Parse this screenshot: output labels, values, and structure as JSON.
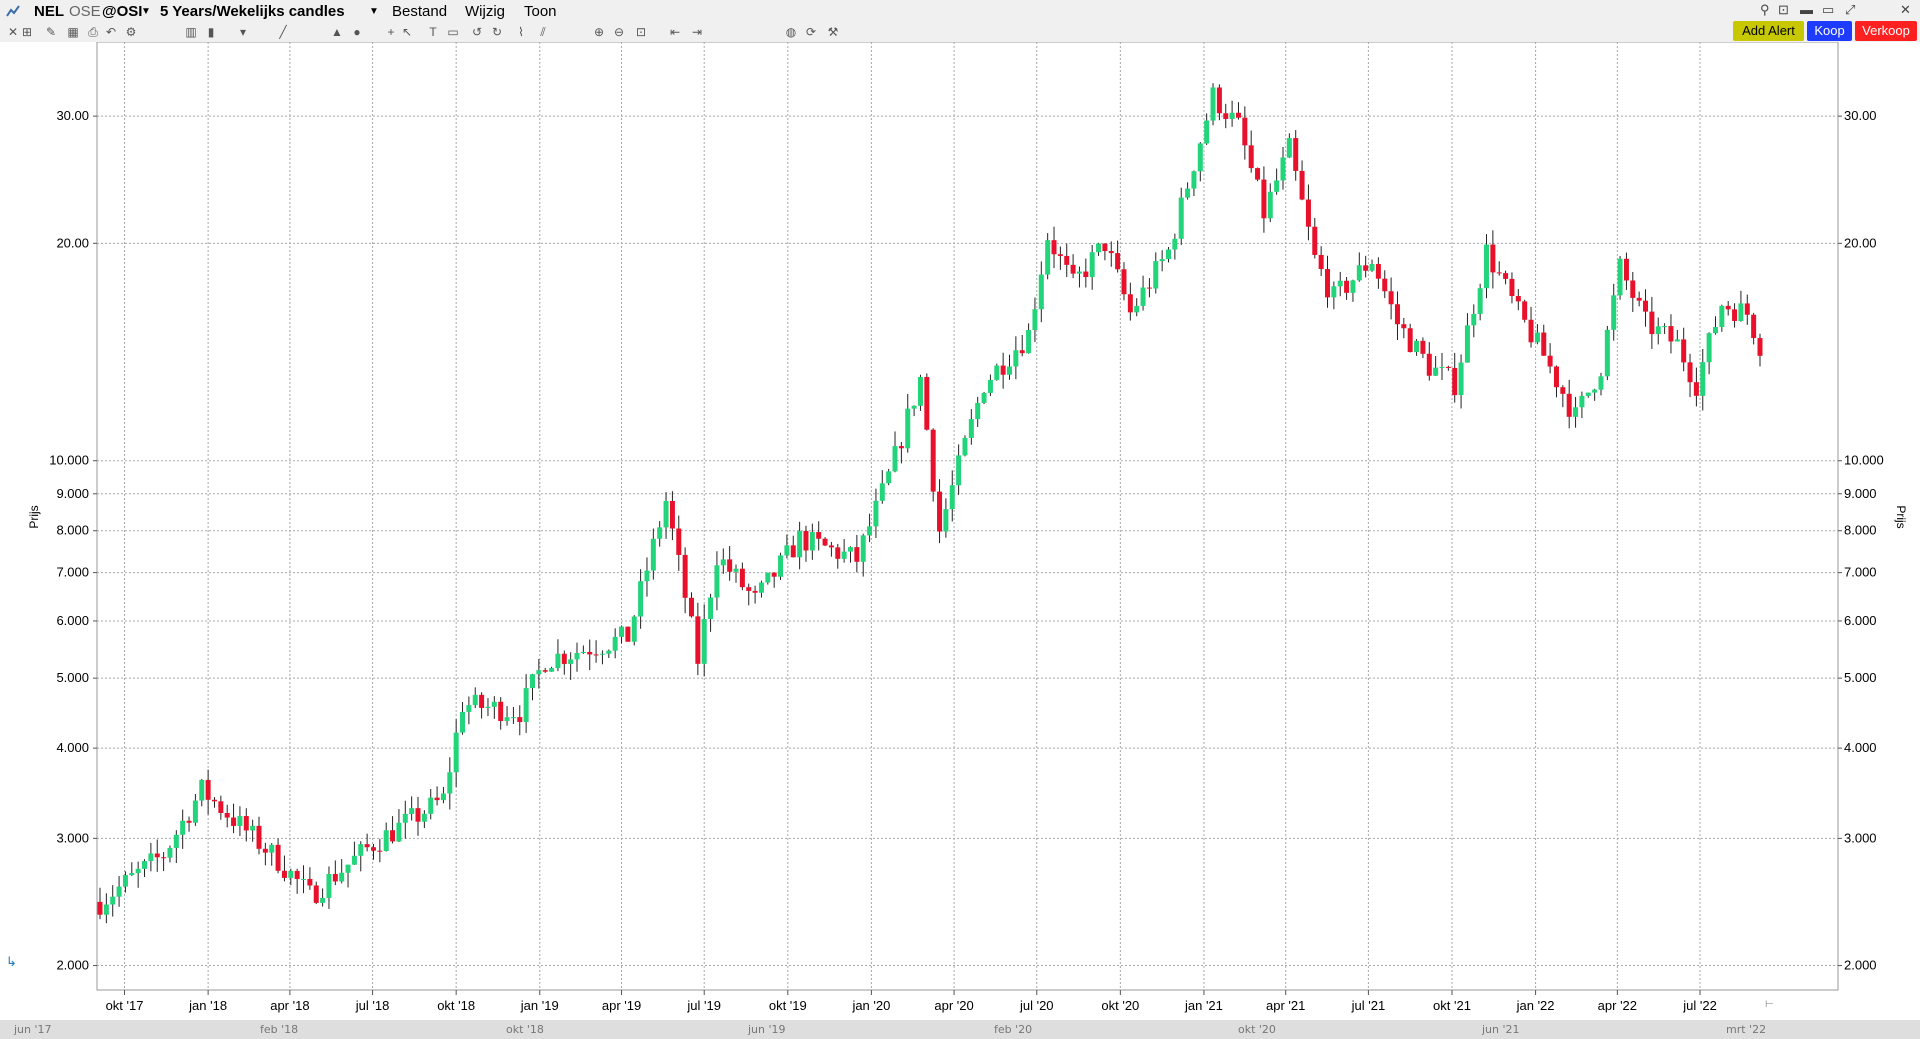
{
  "header": {
    "symbol": "NEL",
    "exchange": "OSE",
    "feed": "@OSI",
    "period": "5 Years/Wekelijks candles",
    "menus": [
      "Bestand",
      "Wijzig",
      "Toon"
    ]
  },
  "actions": {
    "add_alert": "Add Alert",
    "buy": "Koop",
    "sell": "Verkoop"
  },
  "colors": {
    "up": "#22d47a",
    "down": "#e8102a",
    "alert": "#c8c800",
    "buy": "#1e3cff",
    "sell": "#ff2020"
  },
  "icons": [
    "close-icon",
    "crosshair-icon",
    "draw-icon",
    "table-icon",
    "print-icon",
    "undo-icon",
    "settings-icon",
    "line-chart-icon",
    "bar-chart-icon",
    "dropdown-icon",
    "pencil-icon",
    "area-icon",
    "globe-icon",
    "cross-icon",
    "cursor-icon",
    "text-icon",
    "rectangle-icon",
    "undo-arrow-icon",
    "redo-arrow-icon",
    "trend-icon",
    "fibonacci-icon",
    "zoom-in-icon",
    "zoom-out-icon",
    "fit-icon",
    "shift-left-icon",
    "shift-right-icon",
    "world-icon",
    "refresh-icon",
    "tools-icon"
  ],
  "scroller": {
    "labels": [
      "jun '17",
      "feb '18",
      "okt '18",
      "jun '19",
      "feb '20",
      "okt '20",
      "jun '21",
      "mrt '22"
    ]
  },
  "chart_data": {
    "type": "candlestick",
    "title": "",
    "ylabel": "Prijs",
    "yscale": "log",
    "ylim": [
      1.85,
      38
    ],
    "grid": true,
    "y_ticks": [
      "2.000",
      "3.000",
      "4.000",
      "5.000",
      "6.000",
      "7.000",
      "8.000",
      "9.000",
      "10.000",
      "20.00",
      "30.00"
    ],
    "x_ticks": [
      "okt '17",
      "jan '18",
      "apr '18",
      "jul '18",
      "okt '18",
      "jan '19",
      "apr '19",
      "jul '19",
      "okt '19",
      "jan '20",
      "apr '20",
      "jul '20",
      "okt '20",
      "jan '21",
      "apr '21",
      "jul '21",
      "okt '21",
      "jan '22",
      "apr '22",
      "jul '22"
    ],
    "x_period": [
      "2017-09-04",
      "2022-09-05"
    ],
    "key_points": [
      [
        "2017-09-04",
        2.45
      ],
      [
        "2017-11-13",
        2.85
      ],
      [
        "2017-12-25",
        3.5
      ],
      [
        "2018-03-19",
        2.8
      ],
      [
        "2018-04-23",
        2.5
      ],
      [
        "2018-07-02",
        2.95
      ],
      [
        "2018-09-17",
        3.4
      ],
      [
        "2018-10-08",
        4.6
      ],
      [
        "2018-12-10",
        4.5
      ],
      [
        "2019-01-07",
        5.3
      ],
      [
        "2019-04-08",
        5.7
      ],
      [
        "2019-05-20",
        8.8
      ],
      [
        "2019-06-24",
        5.3
      ],
      [
        "2019-07-15",
        7.4
      ],
      [
        "2019-08-26",
        6.4
      ],
      [
        "2019-10-14",
        7.8
      ],
      [
        "2019-12-16",
        7.3
      ],
      [
        "2020-01-20",
        9.5
      ],
      [
        "2020-02-24",
        13.0
      ],
      [
        "2020-03-16",
        8.0
      ],
      [
        "2020-04-13",
        10.5
      ],
      [
        "2020-05-04",
        12.8
      ],
      [
        "2020-06-22",
        15.0
      ],
      [
        "2020-07-13",
        20.5
      ],
      [
        "2020-08-10",
        17.5
      ],
      [
        "2020-09-14",
        20.0
      ],
      [
        "2020-10-12",
        16.0
      ],
      [
        "2020-11-23",
        19.5
      ],
      [
        "2021-01-11",
        32.0
      ],
      [
        "2021-02-08",
        29.0
      ],
      [
        "2021-03-08",
        22.0
      ],
      [
        "2021-04-05",
        27.0
      ],
      [
        "2021-05-03",
        19.0
      ],
      [
        "2021-05-24",
        16.8
      ],
      [
        "2021-07-05",
        19.0
      ],
      [
        "2021-08-02",
        15.5
      ],
      [
        "2021-09-06",
        13.5
      ],
      [
        "2021-10-04",
        12.8
      ],
      [
        "2021-11-08",
        19.5
      ],
      [
        "2021-12-13",
        16.0
      ],
      [
        "2022-01-10",
        14.0
      ],
      [
        "2022-02-14",
        11.5
      ],
      [
        "2022-03-14",
        13.5
      ],
      [
        "2022-04-04",
        18.5
      ],
      [
        "2022-05-02",
        15.5
      ],
      [
        "2022-06-06",
        14.5
      ],
      [
        "2022-06-27",
        12.8
      ],
      [
        "2022-07-25",
        16.5
      ],
      [
        "2022-08-22",
        16.0
      ],
      [
        "2022-09-05",
        14.5
      ]
    ]
  }
}
